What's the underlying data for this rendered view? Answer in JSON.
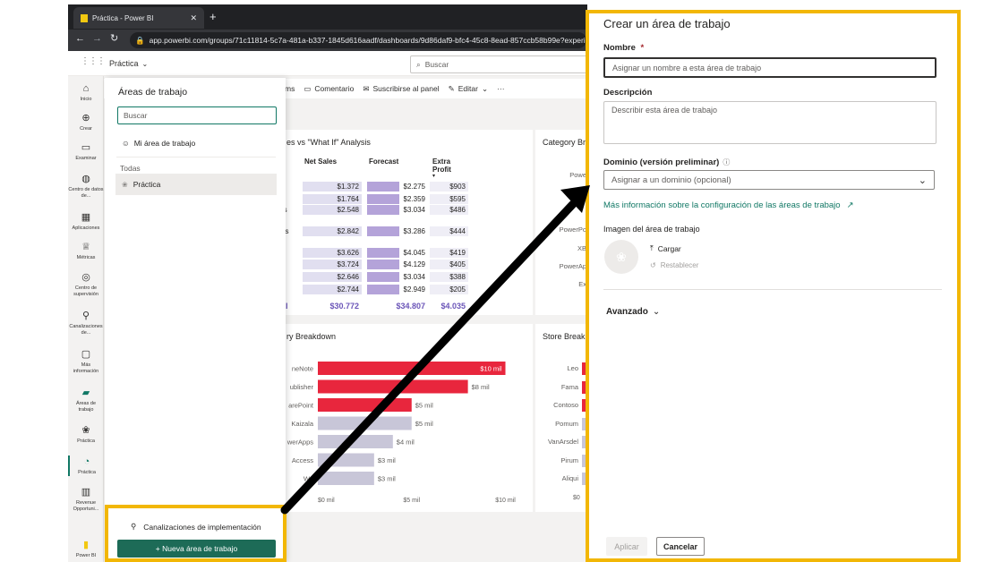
{
  "browser": {
    "tab_title": "Práctica - Power BI",
    "url": "app.powerbi.com/groups/71c11814-5c7a-481a-b337-1845d616aadf/dashboards/9d86daf9-bfc4-45c8-8ead-857ccb58b99e?experien"
  },
  "pbi": {
    "workspace_crumb": "Práctica",
    "search_placeholder": "Buscar"
  },
  "leftnav": {
    "items": [
      {
        "label": "Inicio",
        "icon": "home-icon"
      },
      {
        "label": "Crear",
        "icon": "create-icon"
      },
      {
        "label": "Examinar",
        "icon": "browse-icon"
      },
      {
        "label": "Centro de datos de...",
        "icon": "datahub-icon"
      },
      {
        "label": "Aplicaciones",
        "icon": "apps-icon"
      },
      {
        "label": "Métricas",
        "icon": "metrics-icon"
      },
      {
        "label": "Centro de supervisión",
        "icon": "monitoring-icon"
      },
      {
        "label": "Canalizaciones de...",
        "icon": "pipelines-icon"
      },
      {
        "label": "Más información",
        "icon": "learn-icon"
      },
      {
        "label": "Áreas de trabajo",
        "icon": "workspaces-icon"
      },
      {
        "label": "Práctica",
        "icon": "workspace-icon"
      },
      {
        "label": "Práctica",
        "icon": "gauge-icon"
      },
      {
        "label": "Revenue Opportuni...",
        "icon": "report-icon"
      },
      {
        "label": "Power BI",
        "icon": "powerbi-logo"
      }
    ]
  },
  "toolbar": {
    "partial": "ms",
    "comment": "Comentario",
    "subscribe": "Suscribirse al panel",
    "edit": "Editar",
    "more": "···"
  },
  "report": {
    "matrix_title": "es vs \"What If\" Analysis",
    "matrix_headers": [
      "Net Sales",
      "Forecast",
      "Extra Profit"
    ],
    "matrix_rows": [
      {
        "name": "u",
        "net": "$1.372",
        "fc": "$2.275",
        "ep": "$903"
      },
      {
        "name": "",
        "net": "$1.764",
        "fc": "$2.359",
        "ep": "$595"
      },
      {
        "name": "rs",
        "net": "$2.548",
        "fc": "$3.034",
        "ep": "$486"
      },
      {
        "name": "os",
        "net": "$2.842",
        "fc": "$3.286",
        "ep": "$444"
      },
      {
        "name": "a",
        "net": "$3.626",
        "fc": "$4.045",
        "ep": "$419"
      },
      {
        "name": "i",
        "net": "$3.724",
        "fc": "$4.129",
        "ep": "$405"
      },
      {
        "name": "s",
        "net": "$2.646",
        "fc": "$3.034",
        "ep": "$388"
      },
      {
        "name": "n",
        "net": "$2.744",
        "fc": "$2.949",
        "ep": "$205"
      }
    ],
    "matrix_total": {
      "name": "al",
      "net": "$30.772",
      "fc": "$34.807",
      "ep": "$4.035"
    },
    "cat_title": "Category Br",
    "cat_labels": [
      "Powe",
      "PowerPo",
      "XB",
      "PowerAp",
      "Ex"
    ],
    "bar_title": "ry Breakdown",
    "store_title": "Store Break",
    "store_labels": [
      "Leo",
      "Fama",
      "Contoso",
      "Pomum",
      "VanArsdel",
      "Pirum",
      "Aliqui"
    ],
    "store_axis": "$0"
  },
  "chart_data": {
    "type": "bar",
    "orientation": "horizontal",
    "title": "ry Breakdown",
    "categories": [
      "neNote",
      "ublisher",
      "arePoint",
      "Kaizala",
      "werApps",
      "Access",
      "Wo"
    ],
    "values": [
      10,
      8,
      5,
      5,
      4,
      3,
      3
    ],
    "data_labels": [
      "$10 mil",
      "$8 mil",
      "$5 mil",
      "$5 mil",
      "$4 mil",
      "$3 mil",
      "$3 mil"
    ],
    "x_ticks": [
      "$0 mil",
      "$5 mil",
      "$10 mil"
    ],
    "xlim": [
      0,
      10.5
    ],
    "colors": [
      "#e8263d",
      "#e8263d",
      "#e8263d",
      "#c8c6d8",
      "#c8c6d8",
      "#c8c6d8",
      "#c8c6d8"
    ]
  },
  "flyout": {
    "title": "Áreas de trabajo",
    "search_placeholder": "Buscar",
    "my_workspace": "Mi área de trabajo",
    "section_all": "Todas",
    "item": "Práctica",
    "pipelines": "Canalizaciones de implementación",
    "new_workspace": "+ Nueva área de trabajo"
  },
  "dialog": {
    "title": "Crear un área de trabajo",
    "name_label": "Nombre",
    "required_mark": "*",
    "name_placeholder": "Asignar un nombre a esta área de trabajo",
    "desc_label": "Descripción",
    "desc_placeholder": "Describir esta área de trabajo",
    "domain_label": "Dominio (versión preliminar)",
    "domain_placeholder": "Asignar a un dominio (opcional)",
    "info_link": "Más información sobre la configuración de las áreas de trabajo",
    "image_label": "Imagen del área de trabajo",
    "upload": "Cargar",
    "reset": "Restablecer",
    "advanced": "Avanzado",
    "apply": "Aplicar",
    "cancel": "Cancelar"
  },
  "colors": {
    "highlight": "#f2b705",
    "accent_green": "#117865",
    "bar_red": "#e8263d",
    "bar_grey": "#c8c6d8",
    "forecast_purple": "#b4a3d9",
    "total_purple": "#6b55b8"
  }
}
